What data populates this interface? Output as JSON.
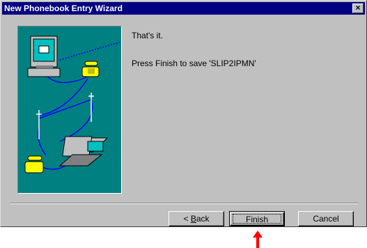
{
  "window": {
    "title": "New Phonebook Entry Wizard",
    "close_glyph": "×"
  },
  "content": {
    "line1": "That's it.",
    "line2": "Press Finish to save 'SLIP2IPMN'"
  },
  "buttons": {
    "back_prefix": "< ",
    "back_accel": "B",
    "back_rest": "ack",
    "finish": "Finish",
    "cancel": "Cancel"
  },
  "colors": {
    "title_bar": "#000080",
    "face": "#c0c0c0",
    "illustration_bg": "#008080",
    "arrow": "#ff0000"
  },
  "icons": [
    "computer-icon",
    "telephone-icon",
    "laptop-icon",
    "telephone-pole-icon",
    "red-arrow-icon"
  ]
}
